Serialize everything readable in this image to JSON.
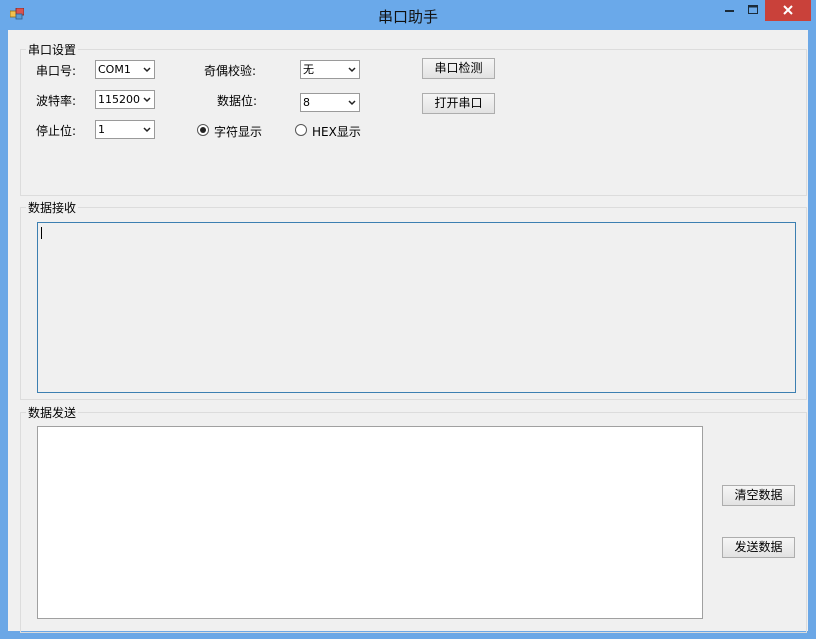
{
  "window": {
    "title": "串口助手"
  },
  "serial_settings": {
    "legend": "串口设置",
    "port_label": "串口号:",
    "port_value": "COM1",
    "baud_label": "波特率:",
    "baud_value": "115200",
    "stop_label": "停止位:",
    "stop_value": "1",
    "parity_label": "奇偶校验:",
    "parity_value": "无",
    "databits_label": "数据位:",
    "databits_value": "8",
    "detect_button": "串口检测",
    "open_button": "打开串口",
    "radio_char": "字符显示",
    "radio_hex": "HEX显示",
    "selected_mode": "字符显示"
  },
  "receive": {
    "legend": "数据接收",
    "content": ""
  },
  "send": {
    "legend": "数据发送",
    "content": "",
    "clear_button": "清空数据",
    "send_button": "发送数据"
  },
  "colors": {
    "titlebar": "#6aa9ea",
    "close_button": "#c9413a",
    "client_bg": "#f0f0f0",
    "focus_border": "#3c7fb1"
  }
}
